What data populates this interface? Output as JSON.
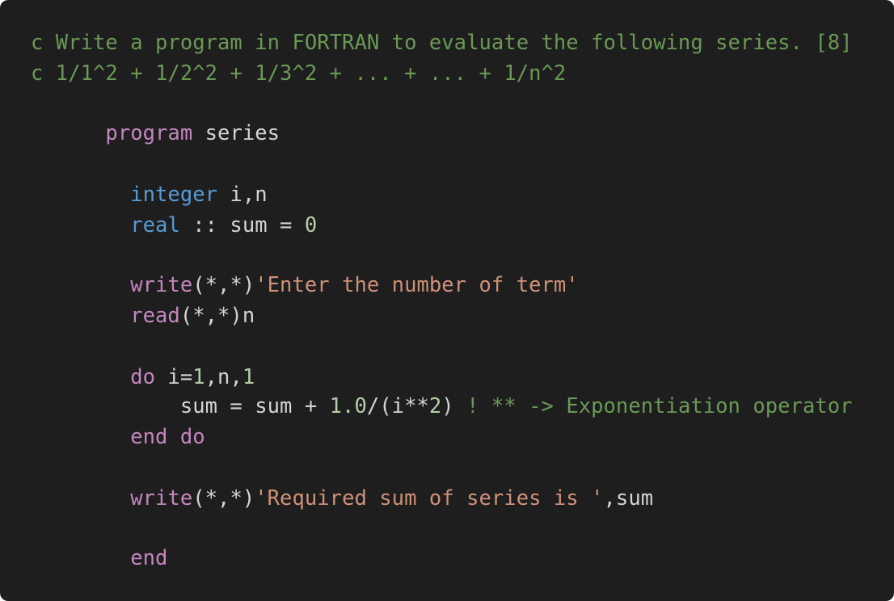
{
  "colors": {
    "background": "#1e1e1e",
    "comment": "#6a9955",
    "keyword": "#c586c0",
    "type": "#569cd6",
    "identifier": "#d4d4d4",
    "number": "#b5cea8",
    "string": "#ce9178"
  },
  "code": {
    "lines": [
      [
        {
          "text": "c Write a program in FORTRAN to evaluate the following series. [8]",
          "kind": "comment"
        }
      ],
      [
        {
          "text": "c 1/1^2 + 1/2^2 + 1/3^2 + ... + ... + 1/n^2",
          "kind": "comment"
        }
      ],
      [
        {
          "text": "      ",
          "kind": "ident"
        },
        {
          "text": "program",
          "kind": "keyword"
        },
        {
          "text": " series",
          "kind": "ident"
        }
      ],
      [
        {
          "text": "        ",
          "kind": "ident"
        },
        {
          "text": "integer",
          "kind": "type"
        },
        {
          "text": " i,n",
          "kind": "ident"
        }
      ],
      [
        {
          "text": "        ",
          "kind": "ident"
        },
        {
          "text": "real",
          "kind": "type"
        },
        {
          "text": " :: sum = ",
          "kind": "ident"
        },
        {
          "text": "0",
          "kind": "number"
        }
      ],
      [
        {
          "text": "        ",
          "kind": "ident"
        },
        {
          "text": "write",
          "kind": "keyword"
        },
        {
          "text": "(*,*)",
          "kind": "ident"
        },
        {
          "text": "'Enter the number of term'",
          "kind": "string"
        }
      ],
      [
        {
          "text": "        ",
          "kind": "ident"
        },
        {
          "text": "read",
          "kind": "keyword"
        },
        {
          "text": "(*,*)n",
          "kind": "ident"
        }
      ],
      [
        {
          "text": "        ",
          "kind": "ident"
        },
        {
          "text": "do",
          "kind": "keyword"
        },
        {
          "text": " i=",
          "kind": "ident"
        },
        {
          "text": "1",
          "kind": "number"
        },
        {
          "text": ",n,",
          "kind": "ident"
        },
        {
          "text": "1",
          "kind": "number"
        }
      ],
      [
        {
          "text": "            sum = sum + ",
          "kind": "ident"
        },
        {
          "text": "1.0",
          "kind": "number"
        },
        {
          "text": "/(i**",
          "kind": "ident"
        },
        {
          "text": "2",
          "kind": "number"
        },
        {
          "text": ") ",
          "kind": "ident"
        },
        {
          "text": "! ** -> Exponentiation operator",
          "kind": "comment"
        }
      ],
      [
        {
          "text": "        ",
          "kind": "ident"
        },
        {
          "text": "end do",
          "kind": "keyword"
        }
      ],
      [
        {
          "text": "        ",
          "kind": "ident"
        },
        {
          "text": "write",
          "kind": "keyword"
        },
        {
          "text": "(*,*)",
          "kind": "ident"
        },
        {
          "text": "'Required sum of series is '",
          "kind": "string"
        },
        {
          "text": ",sum",
          "kind": "ident"
        }
      ],
      [
        {
          "text": "        ",
          "kind": "ident"
        },
        {
          "text": "end",
          "kind": "keyword"
        }
      ]
    ]
  }
}
